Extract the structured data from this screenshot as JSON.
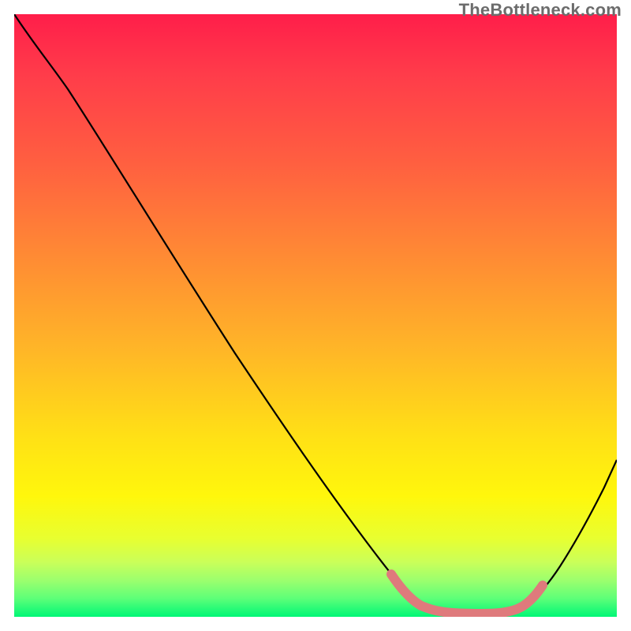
{
  "watermark": {
    "text": "TheBottleneck.com"
  },
  "chart_data": {
    "type": "line",
    "title": "",
    "xlabel": "",
    "ylabel": "",
    "xlim": [
      0,
      100
    ],
    "ylim": [
      0,
      100
    ],
    "grid": false,
    "legend": false,
    "series": [
      {
        "name": "bottleneck-curve",
        "color": "#000000",
        "x": [
          0,
          5,
          10,
          15,
          20,
          25,
          30,
          35,
          40,
          45,
          50,
          55,
          60,
          62,
          64,
          68,
          72,
          76,
          80,
          82,
          84,
          86,
          88,
          90,
          92,
          95,
          98,
          100
        ],
        "y": [
          100,
          94,
          88,
          81,
          74,
          67,
          60,
          53,
          46,
          39,
          32,
          25,
          18,
          14,
          10,
          5,
          2,
          1,
          1,
          1,
          1,
          2,
          4,
          8,
          13,
          21,
          30,
          36
        ]
      },
      {
        "name": "optimal-band-highlight",
        "color": "#e0787a",
        "x": [
          62,
          64,
          68,
          72,
          76,
          80,
          82,
          84,
          86
        ],
        "y": [
          14,
          10,
          5,
          2,
          1,
          1,
          1,
          2,
          4
        ]
      }
    ],
    "annotations": []
  }
}
